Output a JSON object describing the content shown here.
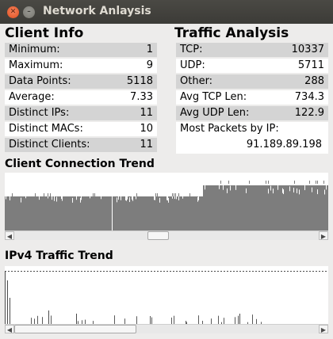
{
  "window": {
    "title": "Network Anlaysis"
  },
  "client_info": {
    "heading": "Client Info",
    "rows": [
      {
        "label": "Minimum:",
        "value": "1"
      },
      {
        "label": "Maximum:",
        "value": "9"
      },
      {
        "label": "Data Points:",
        "value": "5118"
      },
      {
        "label": "Average:",
        "value": "7.33"
      },
      {
        "label": "Distinct IPs:",
        "value": "11"
      },
      {
        "label": "Distinct MACs:",
        "value": "10"
      },
      {
        "label": "Distinct Clients:",
        "value": "11"
      }
    ]
  },
  "traffic_analysis": {
    "heading": "Traffic Analysis",
    "rows": [
      {
        "label": "TCP:",
        "value": "10337"
      },
      {
        "label": "UDP:",
        "value": "5711"
      },
      {
        "label": "Other:",
        "value": "288"
      },
      {
        "label": "Avg TCP  Len:",
        "value": "734.3"
      },
      {
        "label": "Avg UDP Len:",
        "value": "122.9"
      }
    ],
    "most_packets_label": "Most Packets by IP:",
    "most_packets_value": "91.189.89.198"
  },
  "client_trend": {
    "heading": "Client Connection Trend",
    "scroll_position": 0.47,
    "scroll_thumb_fraction": 0.07
  },
  "ipv4_trend": {
    "heading": "IPv4 Traffic Trend",
    "scroll_position": 0.0,
    "scroll_thumb_fraction": 0.4
  },
  "icons": {
    "close": "close-icon",
    "minimize": "minimize-icon",
    "scroll_left": "arrow-left-icon",
    "scroll_right": "arrow-right-icon"
  },
  "colors": {
    "bar": "#7d7d7d",
    "window_background": "#edeceb",
    "row_shade": "#d4d4d4",
    "titlebar": "#3c3b37",
    "close_button": "#e5582a"
  }
}
